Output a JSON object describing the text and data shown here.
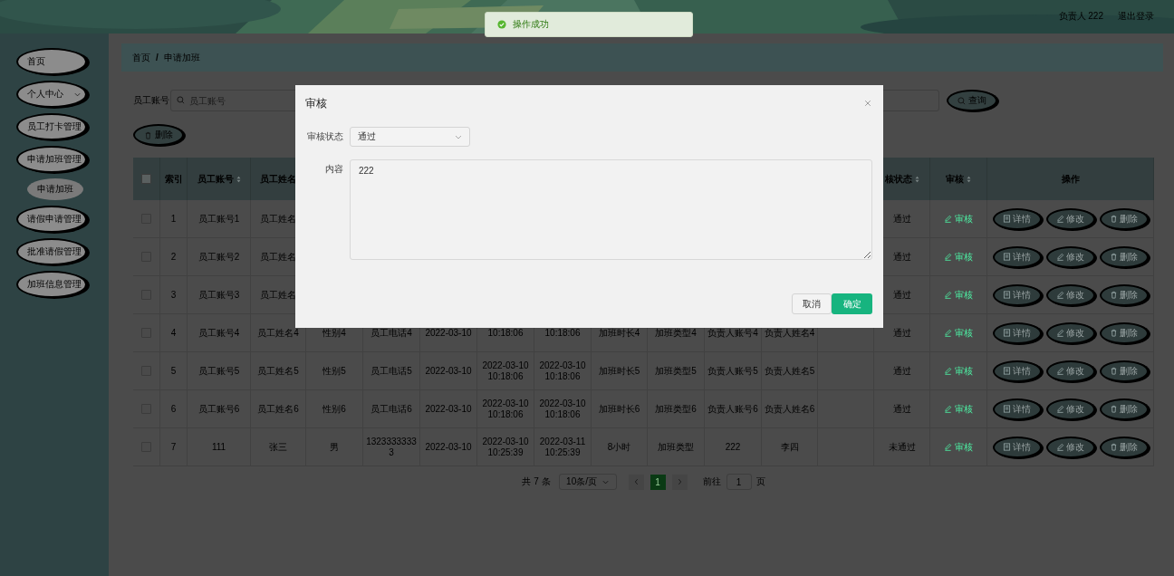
{
  "header": {
    "user": "负责人 222",
    "logout": "退出登录"
  },
  "toast": {
    "kind": "success",
    "message": "操作成功"
  },
  "sidebar": {
    "items": [
      {
        "label": "首页",
        "kind": "link"
      },
      {
        "label": "个人中心",
        "kind": "submenu"
      },
      {
        "label": "员工打卡管理",
        "kind": "link"
      },
      {
        "label": "申请加班管理",
        "kind": "link",
        "children": [
          {
            "label": "申请加班"
          }
        ]
      },
      {
        "label": "请假申请管理",
        "kind": "link"
      },
      {
        "label": "批准请假管理",
        "kind": "link"
      },
      {
        "label": "加班信息管理",
        "kind": "link"
      }
    ]
  },
  "breadcrumb": {
    "items": [
      "首页",
      "申请加班"
    ],
    "separator": "/"
  },
  "search": {
    "label": "员工账号",
    "placeholder": "员工账号",
    "button": "查询"
  },
  "delete_button": "删除",
  "table": {
    "select_all": {
      "checked": false
    },
    "columns": [
      {
        "label": "索引",
        "sortable": false
      },
      {
        "label": "员工账号",
        "sortable": true
      },
      {
        "label": "员工姓名",
        "sortable": false
      },
      null,
      null,
      null,
      null,
      null,
      null,
      null,
      null,
      null,
      null,
      {
        "label": "核状态",
        "sortable": true
      },
      {
        "label": "审核",
        "sortable": true
      },
      {
        "label": "操作",
        "sortable": false
      }
    ],
    "rows": [
      {
        "checked": false,
        "cells": [
          "1",
          "员工账号1",
          "员工姓名",
          null,
          null,
          null,
          null,
          null,
          null,
          null,
          null,
          null,
          null,
          "通过"
        ],
        "audit": "审核",
        "actions": [
          "详情",
          "修改",
          "删除"
        ]
      },
      {
        "checked": false,
        "cells": [
          "2",
          "员工账号2",
          "员工姓名",
          null,
          null,
          null,
          null,
          null,
          null,
          null,
          null,
          null,
          null,
          "通过"
        ],
        "audit": "审核",
        "actions": [
          "详情",
          "修改",
          "删除"
        ]
      },
      {
        "checked": false,
        "cells": [
          "3",
          "员工账号3",
          "员工姓名",
          null,
          null,
          null,
          null,
          null,
          null,
          null,
          null,
          null,
          null,
          "通过"
        ],
        "audit": "审核",
        "actions": [
          "详情",
          "修改",
          "删除"
        ]
      },
      {
        "checked": false,
        "cells": [
          "4",
          "员工账号4",
          "员工姓名4",
          "性别4",
          "员工电话4",
          "2022-03-10",
          "10:18:06",
          "10:18:06",
          "加班时长4",
          "加班类型4",
          "负责人账号4",
          "负责人姓名4",
          null,
          "通过"
        ],
        "audit": "审核",
        "actions": [
          "详情",
          "修改",
          "删除"
        ]
      },
      {
        "checked": false,
        "cells": [
          "5",
          "员工账号5",
          "员工姓名5",
          "性别5",
          "员工电话5",
          "2022-03-10",
          "2022-03-10 10:18:06",
          "2022-03-10 10:18:06",
          "加班时长5",
          "加班类型5",
          "负责人账号5",
          "负责人姓名5",
          null,
          "通过"
        ],
        "audit": "审核",
        "actions": [
          "详情",
          "修改",
          "删除"
        ]
      },
      {
        "checked": false,
        "cells": [
          "6",
          "员工账号6",
          "员工姓名6",
          "性别6",
          "员工电话6",
          "2022-03-10",
          "2022-03-10 10:18:06",
          "2022-03-10 10:18:06",
          "加班时长6",
          "加班类型6",
          "负责人账号6",
          "负责人姓名6",
          null,
          "通过"
        ],
        "audit": "审核",
        "actions": [
          "详情",
          "修改",
          "删除"
        ]
      },
      {
        "checked": false,
        "cells": [
          "7",
          "111",
          "张三",
          "男",
          "13233333333",
          "2022-03-10",
          "2022-03-10 10:25:39",
          "2022-03-11 10:25:39",
          "8小时",
          "加班类型",
          "222",
          "李四",
          null,
          "未通过"
        ],
        "audit": "审核",
        "actions": [
          "详情",
          "修改",
          "删除"
        ]
      }
    ]
  },
  "pagination": {
    "total": "共 7 条",
    "page_size": "10条/页",
    "pages": [
      {
        "label": "1",
        "selected": true
      }
    ],
    "goto_label": "前往",
    "goto_value": "1",
    "goto_suffix": "页"
  },
  "dialog": {
    "title": "审核",
    "fields": [
      {
        "kind": "select",
        "label": "审核状态",
        "value": "通过"
      },
      {
        "kind": "textarea",
        "label": "内容",
        "value": "222"
      }
    ],
    "cancel": "取消",
    "confirm": "确定"
  }
}
